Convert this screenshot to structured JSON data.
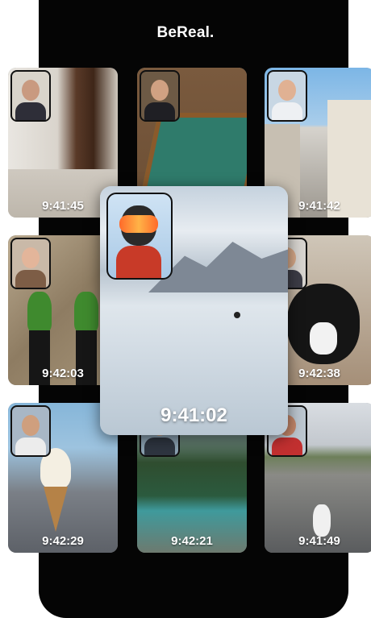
{
  "app": {
    "title": "BeReal."
  },
  "posts": [
    {
      "time": "9:41:45",
      "scene": "room-with-door"
    },
    {
      "time": "",
      "scene": "foosball-table"
    },
    {
      "time": "9:41:42",
      "scene": "city-street"
    },
    {
      "time": "9:42:03",
      "scene": "plant-with-boots"
    },
    {
      "time": "9:42:38",
      "scene": "black-white-cat"
    },
    {
      "time": "9:42:29",
      "scene": "ice-cream-cone"
    },
    {
      "time": "9:42:21",
      "scene": "mountain-lake"
    },
    {
      "time": "9:41:49",
      "scene": "skate-park"
    }
  ],
  "featured": {
    "time": "9:41:02",
    "scene": "snowboarder-on-slope"
  }
}
